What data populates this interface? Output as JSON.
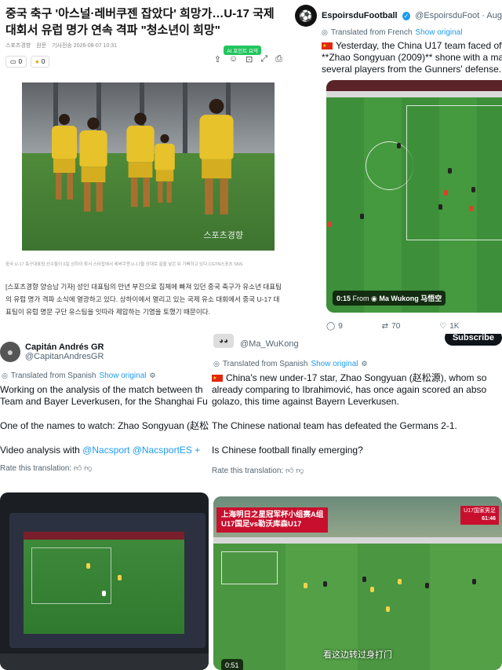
{
  "korean_article": {
    "headline": "중국 축구 '아스널·레버쿠젠 잡았다' 희망가…U-17 국제대회서 유럽 명가 연속 격파 \"청소년이 희망\"",
    "source": "스포츠경향",
    "reporter": "원문",
    "date": "기사전송 2026-08-07 10:31",
    "comment_count": "0",
    "like_count": "0",
    "ai_badge": "AI 포인트 요약",
    "photo_watermark": "스포츠경향",
    "caption": "중국 U-17 축구대표팀 선수들이 6일 상하이 류서 스타잡에서 레버쿠젠 U-17을 상대로 골을 넣은 뒤 기뻐하고 있다.CGTN스포츠 SNS",
    "body": "[스포츠경향 양승남 기자] 성인 대표팀의 만년 부진으로 침체에 빠져 있던 중국 축구가 유소년 대표팀의 유럽 명가 격파 소식에 열광하고 있다. 상하이에서 열리고 있는 국제 유소 대회에서 중국 U-17 대표팀이 유럽 명문 구단 유스팀을 잇따라 제압하는 기염을 토했기 때문이다."
  },
  "tweet_espoirs": {
    "name": "EspoirsduFootball",
    "handle": "@EspoirsduFoot · Aug",
    "translated_label": "Translated from French",
    "show_original": "Show original",
    "lines": [
      "Yesterday, the China U17 team faced off a",
      "**Zhao Songyuan (2009)** shone with a mag",
      "several players from the Gunners' defense."
    ],
    "video_time": "0:15",
    "video_from": "From",
    "video_source": "Ma Wukong 马悟空",
    "replies": "9",
    "retweets": "70",
    "likes": "1K"
  },
  "tweet_capitan": {
    "name": "Capitán Andrés GR",
    "handle": "@CapitanAndresGR",
    "translated_label": "Translated from Spanish",
    "show_original": "Show original",
    "line1": "Working on the analysis of the match between th",
    "line2": "Team and Bayer Leverkusen, for the Shanghai Fu",
    "line3": "One of the names to watch: Zhao Songyuan (赵松",
    "line4_prefix": "Video analysis with ",
    "line4_links": "@Nacsport @NacsportES + ",
    "rate": "Rate this translation:"
  },
  "tweet_mawukong": {
    "handle": "@Ma_WuKong",
    "subscribe": "Subscribe",
    "translated_label": "Translated from Spanish",
    "show_original": "Show original",
    "line1": "China's new under-17 star, Zhao Songyuan (赵松源), whom so",
    "line2": "already comparing to Ibrahimović, has once again scored an abso",
    "line3": "golazo, this time against Bayern Leverkusen.",
    "line4": "The Chinese national team has defeated the Germans 2-1.",
    "line5": "Is Chinese football finally emerging?",
    "rate": "Rate this translation:",
    "banner_line1": "上海明日之星冠军杯小组赛A组",
    "banner_line2": "U17国足vs勒沃库森U17",
    "score_label": "U17国家男足",
    "score_time": "61:46",
    "subtitle": "看这边转过身打门",
    "video_time": "0:51"
  }
}
